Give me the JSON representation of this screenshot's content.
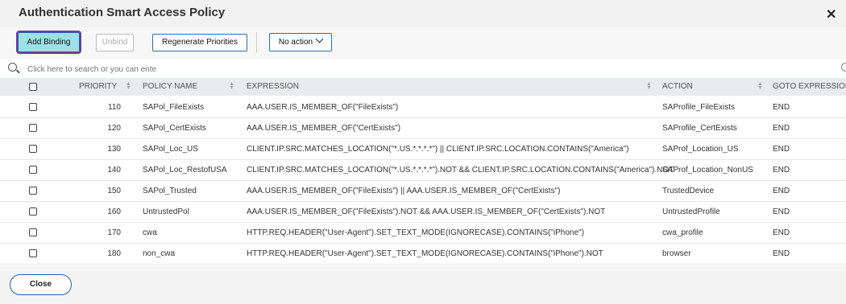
{
  "dialog": {
    "title": "Authentication Smart Access Policy"
  },
  "toolbar": {
    "add_binding": "Add Binding",
    "unbind": "Unbind",
    "regenerate": "Regenerate Priorities",
    "action_select": "No action"
  },
  "search": {
    "placeholder": "Click here to search or you can ente"
  },
  "table": {
    "columns": [
      "PRIORITY",
      "POLICY NAME",
      "EXPRESSION",
      "ACTION",
      "GOTO EXPRESSION"
    ],
    "rows": [
      {
        "priority": "110",
        "name": "SAPol_FileExists",
        "expression": "AAA.USER.IS_MEMBER_OF(\"FileExists\")",
        "action": "SAProfile_FileExists",
        "goto": "END"
      },
      {
        "priority": "120",
        "name": "SAPol_CertExists",
        "expression": "AAA.USER.IS_MEMBER_OF(\"CertExists\")",
        "action": "SAProfile_CertExists",
        "goto": "END"
      },
      {
        "priority": "130",
        "name": "SAPol_Loc_US",
        "expression": "CLIENT.IP.SRC.MATCHES_LOCATION(\"*.US.*.*.*.*\") || CLIENT.IP.SRC.LOCATION.CONTAINS(\"America\")",
        "action": "SAProf_Location_US",
        "goto": "END"
      },
      {
        "priority": "140",
        "name": "SAPol_Loc_RestofUSA",
        "expression": "CLIENT.IP.SRC.MATCHES_LOCATION(\"*.US.*.*.*.*\").NOT && CLIENT.IP.SRC.LOCATION.CONTAINS(\"America\").NOT",
        "action": "SAProf_Location_NonUS",
        "goto": "END"
      },
      {
        "priority": "150",
        "name": "SAPol_Trusted",
        "expression": "AAA.USER.IS_MEMBER_OF(\"FileExists\") || AAA.USER.IS_MEMBER_OF(\"CertExists\")",
        "action": "TrustedDevice",
        "goto": "END"
      },
      {
        "priority": "160",
        "name": "UntrustedPol",
        "expression": "AAA.USER.IS_MEMBER_OF(\"FileExists\").NOT && AAA.USER.IS_MEMBER_OF(\"CertExists\").NOT",
        "action": "UntrustedProfile",
        "goto": "END"
      },
      {
        "priority": "170",
        "name": "cwa",
        "expression": "HTTP.REQ.HEADER(\"User-Agent\").SET_TEXT_MODE(IGNORECASE).CONTAINS(\"iPhone\")",
        "action": "cwa_profile",
        "goto": "END"
      },
      {
        "priority": "180",
        "name": "non_cwa",
        "expression": "HTTP.REQ.HEADER(\"User-Agent\").SET_TEXT_MODE(IGNORECASE).CONTAINS(\"iPhone\").NOT",
        "action": "browser",
        "goto": "END"
      }
    ]
  },
  "footer": {
    "close_label": "Close"
  }
}
